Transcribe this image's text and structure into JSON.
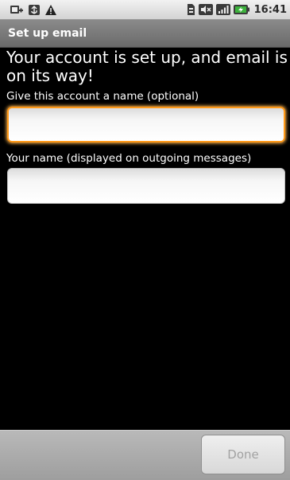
{
  "status_bar": {
    "time": "16:41",
    "left_icons": [
      "usb-debug-icon",
      "usb-connected-icon",
      "warning-icon"
    ],
    "right_icons": [
      "sim-icon",
      "mute-icon",
      "signal-icon",
      "battery-charging-icon"
    ]
  },
  "title_bar": {
    "title": "Set up email"
  },
  "main": {
    "headline": "Your account is set up, and email is on its way!",
    "account_name_label": "Give this account a name (optional)",
    "account_name_value": "",
    "your_name_label": "Your name (displayed on outgoing messages)",
    "your_name_value": ""
  },
  "footer": {
    "done_label": "Done"
  },
  "colors": {
    "focus_accent": "#ff9a1a",
    "battery_green": "#3db23d",
    "warning_dark": "#222222"
  }
}
